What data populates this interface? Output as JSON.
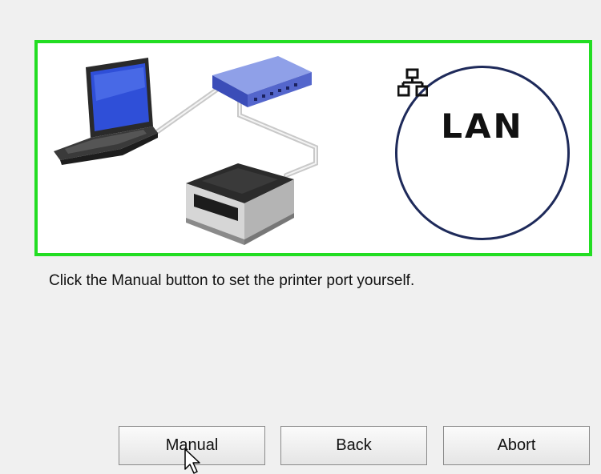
{
  "illustration": {
    "badge_label": "LAN",
    "frame_color": "#22dd22",
    "icons": [
      "laptop-icon",
      "router-icon",
      "printer-icon",
      "network-icon"
    ]
  },
  "instruction_text": "Click the Manual button to set the printer port yourself.",
  "buttons": {
    "manual": "Manual",
    "back": "Back",
    "abort": "Abort"
  }
}
